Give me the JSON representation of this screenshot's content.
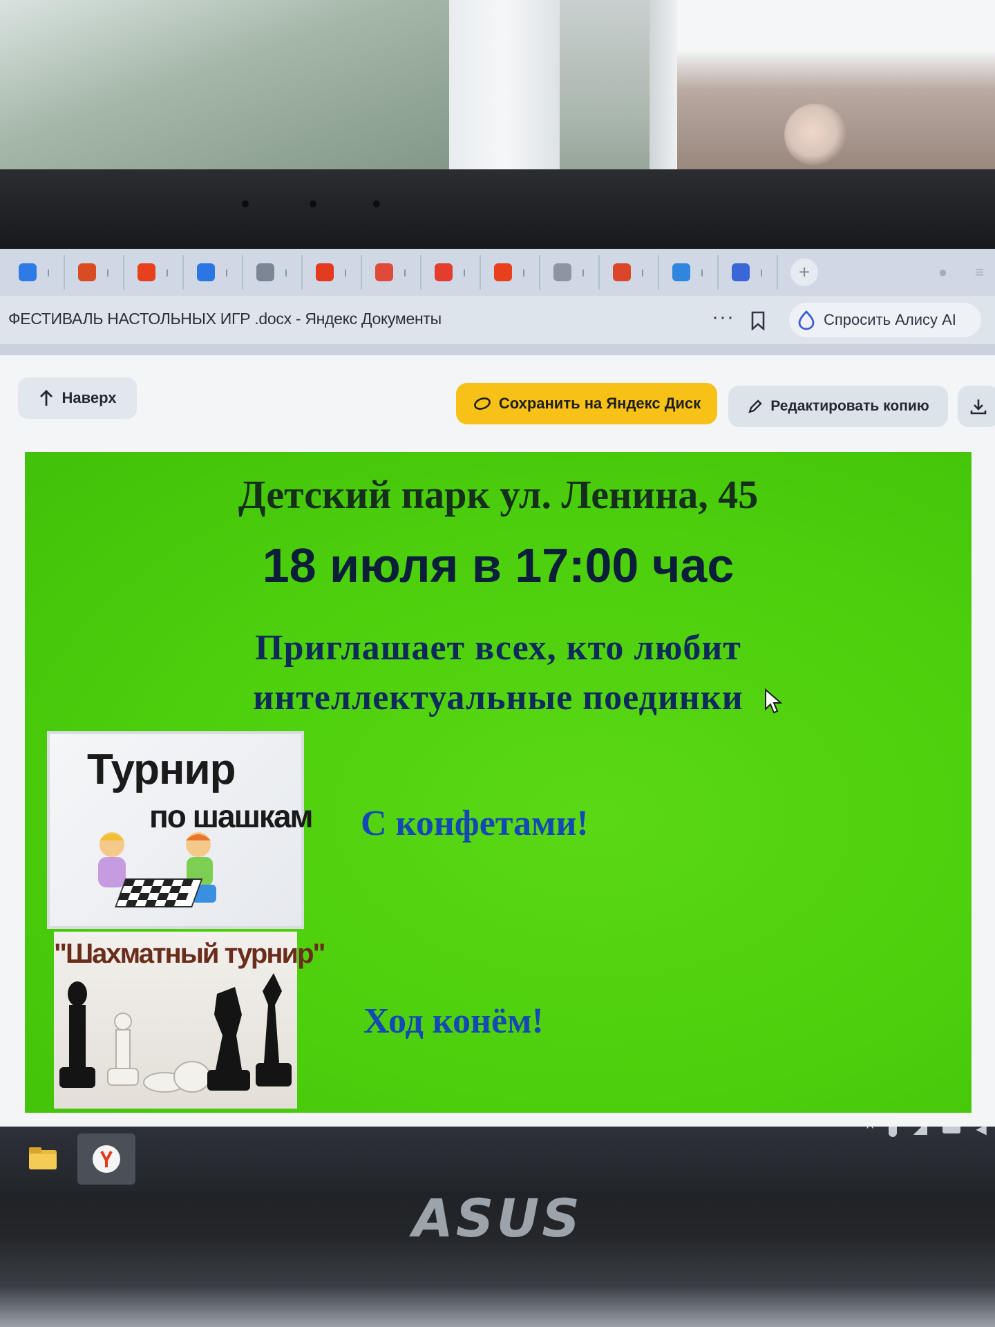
{
  "browser": {
    "tabs": [
      {
        "color": "#2f7be6"
      },
      {
        "color": "#d94b22"
      },
      {
        "color": "#e8401c"
      },
      {
        "color": "#2b76e3"
      },
      {
        "color": "#7c8593"
      },
      {
        "color": "#e33a1e"
      },
      {
        "color": "#e04a3a"
      },
      {
        "color": "#e23d2e"
      },
      {
        "color": "#e8401c"
      },
      {
        "color": "#8c95a1"
      },
      {
        "color": "#d9462a"
      },
      {
        "color": "#2f86de"
      },
      {
        "color": "#3a67d8"
      }
    ],
    "tab_close_glyph": "ı",
    "new_tab_glyph": "+",
    "document_title": "ФЕСТИВАЛЬ НАСТОЛЬНЫХ ИГР .docx - Яндекс Документы",
    "more_glyph": "···",
    "alice_button_label": "Спросить Алису AI"
  },
  "toolbar": {
    "top_label": "Наверх",
    "save_label": "Сохранить на Яндекс Диск",
    "edit_label": "Редактировать копию"
  },
  "poster": {
    "address": "Детский парк ул. Ленина, 45",
    "date": "18 июля в 17:00 час",
    "invite_line1": "Приглашает всех, кто любит",
    "invite_line2": "интеллектуальные поединки",
    "checkers_title": "Турнир",
    "checkers_subtitle": "по шашкам",
    "candy_text": "С конфетами!",
    "chess_title": "\"Шахматный турнир\"",
    "knight_text": "Ход конём!"
  },
  "laptop": {
    "brand": "ASUS"
  },
  "colors": {
    "poster_green": "#4ccf0c",
    "save_button": "#f7c117",
    "accent_blue": "#1448b4"
  }
}
